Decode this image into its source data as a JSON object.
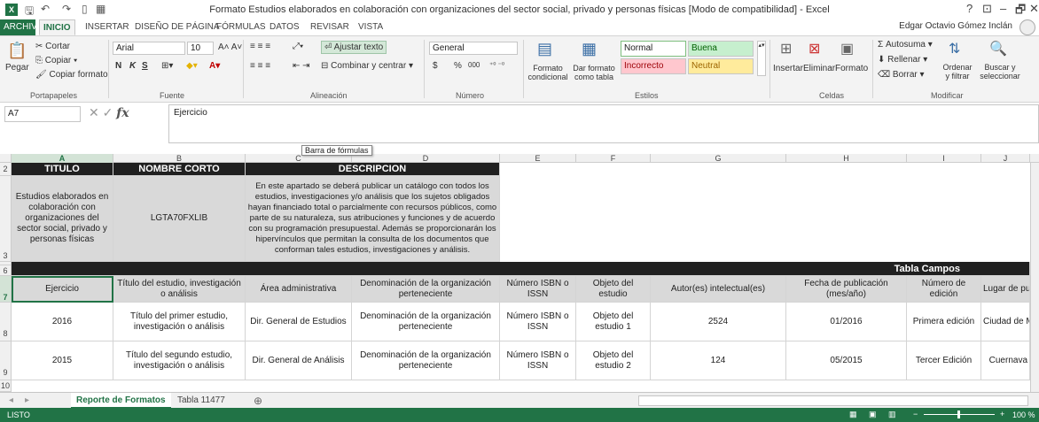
{
  "window": {
    "title": "Formato Estudios elaborados en colaboración con organizaciones del sector social, privado y personas físicas  [Modo de compatibilidad] - Excel",
    "user": "Edgar Octavio Gómez Inclán",
    "controls": [
      "?",
      "⊡",
      "–",
      "🗗",
      "✕"
    ]
  },
  "tabs": [
    "ARCHIVO",
    "INICIO",
    "INSERTAR",
    "DISEÑO DE PÁGINA",
    "FÓRMULAS",
    "DATOS",
    "REVISAR",
    "VISTA"
  ],
  "ribbon": {
    "clipboard": {
      "paste": "Pegar",
      "cut": "Cortar",
      "copy": "Copiar",
      "format_painter": "Copiar formato",
      "group": "Portapapeles"
    },
    "font": {
      "name": "Arial",
      "size": "10",
      "bold": "N",
      "italic": "K",
      "underline": "S",
      "group": "Fuente"
    },
    "alignment": {
      "wrap": "Ajustar texto",
      "merge": "Combinar y centrar",
      "group": "Alineación"
    },
    "number": {
      "format": "General",
      "currency": "$",
      "percent": "%",
      "thousands": "000",
      "group": "Número"
    },
    "styles": {
      "cond_format": "Formato condicional",
      "table_format": "Dar formato como tabla",
      "normal": "Normal",
      "good": "Buena",
      "bad": "Incorrecto",
      "neutral": "Neutral",
      "group": "Estilos"
    },
    "cells": {
      "insert": "Insertar",
      "delete": "Eliminar",
      "format": "Formato",
      "group": "Celdas"
    },
    "editing": {
      "autosum": "Autosuma",
      "fill": "Rellenar",
      "clear": "Borrar",
      "sort": "Ordenar y filtrar",
      "find": "Buscar y seleccionar",
      "group": "Modificar"
    }
  },
  "formula_bar": {
    "name_box": "A7",
    "fx": "fx",
    "content": "Ejercicio",
    "tooltip": "Barra de fórmulas"
  },
  "columns": [
    "A",
    "B",
    "C",
    "D",
    "E",
    "F",
    "G",
    "H",
    "I",
    "J"
  ],
  "rows": {
    "r2": {
      "num": "2",
      "a": "TITULO",
      "b": "NOMBRE CORTO",
      "cd": "DESCRIPCION"
    },
    "r3": {
      "num": "3",
      "a": "Estudios elaborados en colaboración con organizaciones del sector social, privado y personas físicas",
      "b": "LGTA70FXLIB",
      "cd": "En este apartado se deberá publicar un catálogo con todos los estudios, investigaciones y/o análisis que los sujetos obligados hayan financiado total o parcialmente con recursos públicos, como parte de su naturaleza, sus atribuciones y funciones y de acuerdo con su programación presupuestal. Además se proporcionarán los hipervínculos que permitan la consulta de los documentos que conforman tales estudios, investigaciones y análisis."
    },
    "r6": {
      "num": "6",
      "label": "Tabla Campos"
    },
    "r7": {
      "num": "7",
      "cells": [
        "Ejercicio",
        "Título del estudio, investigación o análisis",
        "Área administrativa",
        "Denominación de la organización perteneciente",
        "Número ISBN o ISSN",
        "Objeto del estudio",
        "Autor(es) intelectual(es)",
        "Fecha de publicación (mes/año)",
        "Número de edición",
        "Lugar de pub"
      ]
    },
    "r8": {
      "num": "8",
      "cells": [
        "2016",
        "Título del primer estudio, investigación o análisis",
        "Dir. General de Estudios",
        "Denominación de la organización perteneciente",
        "Número ISBN o ISSN",
        "Objeto del estudio 1",
        "2524",
        "01/2016",
        "Primera edición",
        "Ciudad de M"
      ]
    },
    "r9": {
      "num": "9",
      "cells": [
        "2015",
        "Título del segundo estudio, investigación o análisis",
        "Dir. General de Análisis",
        "Denominación de la organización perteneciente",
        "Número ISBN o ISSN",
        "Objeto del estudio 2",
        "124",
        "05/2015",
        "Tercer Edición",
        "Cuernava"
      ]
    },
    "r10": {
      "num": "10"
    }
  },
  "sheets": [
    "Reporte de Formatos",
    "Tabla 11477"
  ],
  "status": {
    "ready": "LISTO",
    "zoom": "100 %"
  }
}
